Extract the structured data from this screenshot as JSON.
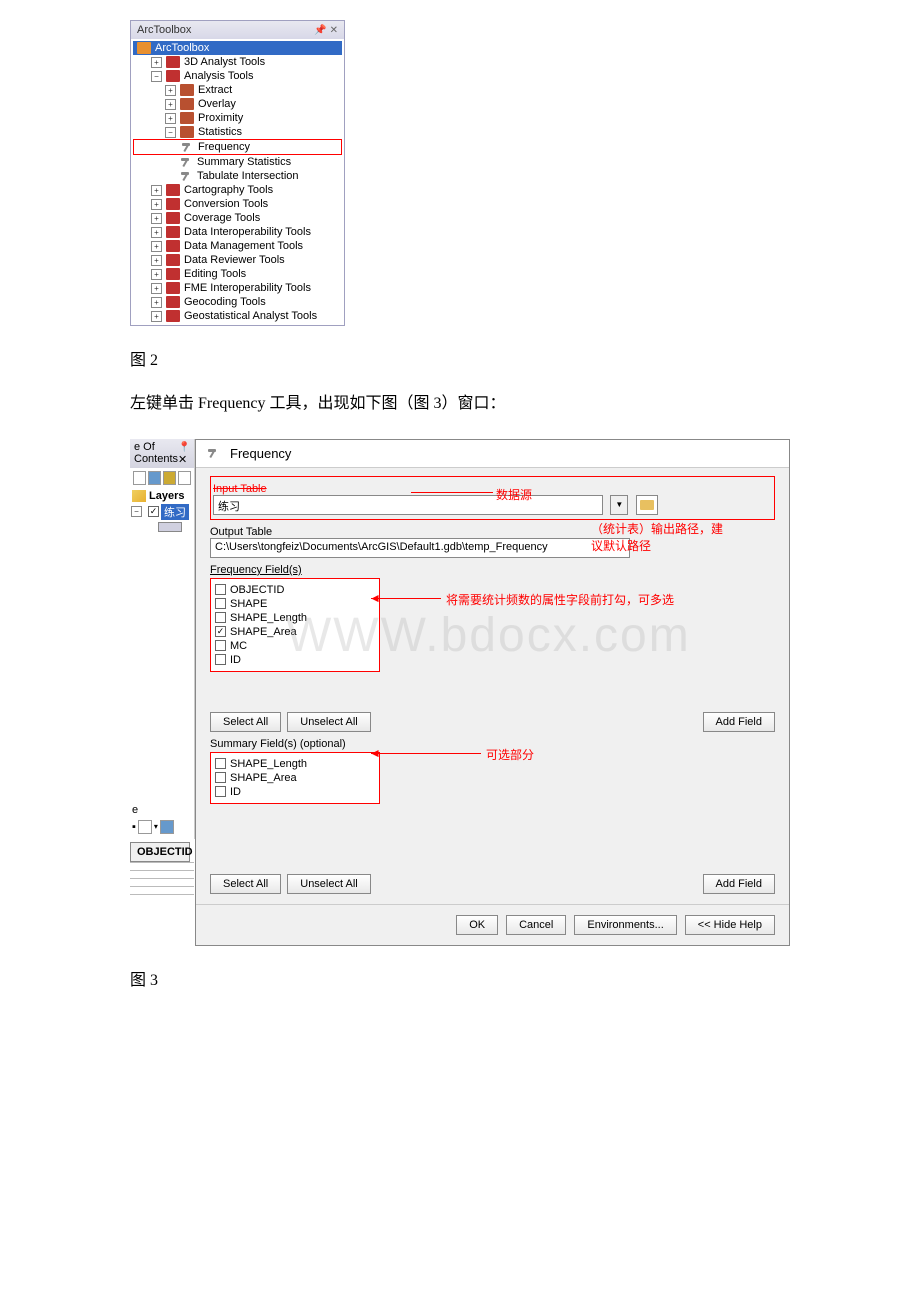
{
  "toolbox": {
    "header": "ArcToolbox",
    "root": "ArcToolbox",
    "items": {
      "analyst3d": "3D Analyst Tools",
      "analysis": "Analysis Tools",
      "extract": "Extract",
      "overlay": "Overlay",
      "proximity": "Proximity",
      "statistics": "Statistics",
      "frequency": "Frequency",
      "summary_stats": "Summary Statistics",
      "tabulate": "Tabulate Intersection",
      "cartography": "Cartography Tools",
      "conversion": "Conversion Tools",
      "coverage": "Coverage Tools",
      "interop": "Data Interoperability Tools",
      "datamgmt": "Data Management Tools",
      "reviewer": "Data Reviewer Tools",
      "editing": "Editing Tools",
      "fme": "FME Interoperability Tools",
      "geocoding": "Geocoding Tools",
      "geostat": "Geostatistical Analyst Tools"
    }
  },
  "caption_fig2": "图 2",
  "body_text": "左键单击 Frequency 工具，出现如下图（图 3）窗口：",
  "caption_fig3": "图 3",
  "toc": {
    "header": "e Of Contents",
    "layers": "Layers",
    "layer_name": "练习",
    "e": "e",
    "objectid": "OBJECTID"
  },
  "freq": {
    "title": "Frequency",
    "input_label": "Input Table",
    "input_value": "练习",
    "output_label": "Output Table",
    "output_value": "C:\\Users\\tongfeiz\\Documents\\ArcGIS\\Default1.gdb\\temp_Frequency",
    "fields_label": "Frequency Field(s)",
    "fields": {
      "objectid": "OBJECTID",
      "shape": "SHAPE",
      "shape_length": "SHAPE_Length",
      "shape_area": "SHAPE_Area",
      "mc": "MC",
      "id": "ID"
    },
    "summary_label": "Summary Field(s) (optional)",
    "summary": {
      "shape_length": "SHAPE_Length",
      "shape_area": "SHAPE_Area",
      "id": "ID"
    },
    "select_all": "Select All",
    "unselect_all": "Unselect All",
    "add_field": "Add Field",
    "ok": "OK",
    "cancel": "Cancel",
    "environments": "Environments...",
    "hide_help": "<< Hide Help"
  },
  "annotations": {
    "data_source": "数据源",
    "output_path": "（统计表）输出路径，建议默认路径",
    "freq_fields": "将需要统计频数的属性字段前打勾，可多选",
    "optional_part": "可选部分"
  }
}
